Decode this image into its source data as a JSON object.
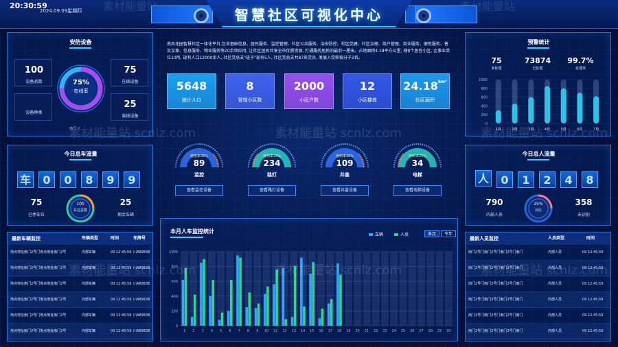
{
  "header": {
    "title": "智慧社区可视化中心",
    "clock": "20:30:59",
    "date": "2024.09.09星期四",
    "ghost_left": "素材能量站",
    "ghost_right": "素材能量站"
  },
  "watermark": "素材能量站 scnlz.com",
  "security": {
    "title": "安防设备",
    "total_value": "100",
    "total_label": "设备总数",
    "types_label": "设备种类",
    "ring_pct": "75%",
    "ring_label": "在线率",
    "ring_fraction": 0.75,
    "online_value": "75",
    "online_label": "在线设备",
    "offline_value": "25",
    "offline_label": "离线设备",
    "footnote": "南门 人"
  },
  "intro": "南风花园智慧社区一体化平台,包含基础信息、居民服务、监控管理、社区公共服务、治安防控、社区党建、社区治理、商户管理、商业服务、便民服务、普及议事、信息服务、物业服务等20余项应用, 让社区居民共享全市优质资源, 打通服务居民的最后一厘米。占地面积4.18平方公里, 辖8个居住小区, 企事业单位10所, 现有人口12000余人, 社区党总支\"班子\"现有5人, 社区党总支共87名党员, 发展入党积极分子2名。",
  "stats": [
    {
      "value": "5648",
      "label": "统计人口",
      "color": "#1aa0f2"
    },
    {
      "value": "8",
      "label": "管辖小区数",
      "color": "#3f63f0"
    },
    {
      "value": "2000",
      "label": "小区户数",
      "color": "#9a4ff2"
    },
    {
      "value": "12",
      "label": "小区楼栋",
      "color": "#3358e8"
    },
    {
      "value": "24.18",
      "unit": "km²",
      "label": "社区面积",
      "color": "#1b9af0"
    }
  ],
  "gauges": [
    {
      "rate_label": "使用率98%",
      "value": "89",
      "name": "监控",
      "button": "查看监控设备",
      "color": "#2f6df0"
    },
    {
      "rate_label": "使用率25%",
      "value": "234",
      "name": "路灯",
      "button": "查看路灯设备",
      "color": "#27c7c0"
    },
    {
      "rate_label": "使用率98%",
      "value": "109",
      "name": "井盖",
      "button": "查看井盖设备",
      "color": "#2f6df0"
    },
    {
      "rate_label": "使用率25%",
      "value": "34",
      "name": "电梯",
      "button": "查看电梯设备",
      "color": "#27c7c0"
    }
  ],
  "alerts": {
    "title": "预警统计",
    "items": [
      {
        "value": "75",
        "label": "未处理"
      },
      {
        "value": "73874",
        "label": "已处理"
      },
      {
        "value": "99.7%",
        "label": "处理率"
      }
    ]
  },
  "alert_chart": {
    "type": "bar",
    "categories": [
      "1月",
      "2月",
      "3月",
      "4月",
      "5月",
      "6月",
      "7月"
    ],
    "values": [
      300,
      450,
      600,
      850,
      800,
      700,
      620
    ],
    "ylim": [
      0,
      1000
    ],
    "yticks": [
      "1000",
      "800",
      "600",
      "400",
      "200",
      "0"
    ]
  },
  "vehicle_flow": {
    "title": "今日总车流量",
    "prefix": "车",
    "digits": [
      "0",
      "0",
      "8",
      "9",
      "9"
    ],
    "parked_value": "75",
    "parked_label": "已停车位",
    "ring_value": "100",
    "ring_label": "车位总数",
    "remain_value": "25",
    "remain_label": "剩余车辆"
  },
  "people_flow": {
    "title": "今日总人流量",
    "prefix": "人",
    "digits": [
      "0",
      "1",
      "2",
      "4",
      "8"
    ],
    "inner_value": "790",
    "inner_label": "内部人员",
    "ring_value": "25%",
    "ring_label": "对比",
    "unknown_value": "358",
    "unknown_label": "未识别"
  },
  "chart_data": {
    "type": "bar",
    "title": "本月人车监控统计",
    "tabs": [
      "本月",
      "今年"
    ],
    "categories": [
      "1",
      "2",
      "3",
      "4",
      "5",
      "6",
      "7",
      "8",
      "9",
      "10",
      "11",
      "12",
      "13",
      "14",
      "15",
      "16",
      "17",
      "18",
      "19",
      "20",
      "21",
      "22",
      "23",
      "24",
      "25",
      "26",
      "27",
      "28",
      "29",
      "30"
    ],
    "xticks": [
      "1",
      "2",
      "3",
      "4",
      "5",
      "6",
      "7",
      "8",
      "9",
      "10",
      "11",
      "12",
      "13",
      "14",
      "15",
      "16",
      "17",
      "18",
      "19",
      "20",
      "21",
      "22",
      "23",
      "24",
      "25",
      "26",
      "27",
      "28",
      "29",
      "30"
    ],
    "yticks": [
      "1000",
      "800",
      "600",
      "400",
      "200",
      "0"
    ],
    "ylim": [
      0,
      1000
    ],
    "series": [
      {
        "name": "车辆",
        "color": "#2ea6ff",
        "values": [
          620,
          120,
          850,
          400,
          80,
          200,
          950,
          250,
          240,
          430,
          560,
          780,
          120,
          920,
          700,
          100,
          300,
          840,
          0,
          0,
          0,
          0,
          0,
          0,
          0,
          0,
          0,
          0,
          0,
          0
        ]
      },
      {
        "name": "人员",
        "color": "#27d98a",
        "values": [
          780,
          420,
          900,
          620,
          180,
          620,
          920,
          450,
          300,
          530,
          760,
          90,
          810,
          260,
          860,
          230,
          360,
          690,
          0,
          0,
          0,
          0,
          0,
          0,
          0,
          0,
          0,
          0,
          0,
          0
        ]
      }
    ]
  },
  "vehicle_table": {
    "title": "最新车辆监控",
    "headers": [
      "车辆类型",
      "时间",
      "车牌号"
    ],
    "rows": [
      {
        "addr": "地点地址南门2号门地点地址南门2号",
        "type": "内部车辆",
        "time": "09 12:45:59",
        "plate": "川A89838"
      },
      {
        "addr": "地点地址南门2号门地点地址南门2号",
        "type": "内部车辆",
        "time": "09 12:45:59",
        "plate": "川A89838"
      },
      {
        "addr": "地点地址南门2号门地点地址南门2号",
        "type": "内部车辆",
        "time": "09 12:45:59",
        "plate": "川A89838"
      },
      {
        "addr": "地点地址南门2号门地点地址南门2号",
        "type": "内部车辆",
        "time": "09 12:45:59",
        "plate": "川A89838"
      },
      {
        "addr": "地点地址南门2号门地点地址南门2号",
        "type": "内部车辆",
        "time": "09 12:45:59",
        "plate": "川A89838"
      },
      {
        "addr": "地点地址南门2号门地点地址南门2号",
        "type": "内部车辆",
        "time": "09 12:45:59",
        "plate": "川A89838"
      }
    ]
  },
  "people_table": {
    "title": "最新人员监控",
    "headers": [
      "人员类型",
      "时间"
    ],
    "rows": [
      {
        "addr": "南门2号门南门2号门南门2号门南门",
        "type": "内部人员",
        "time": "09 12:45:59"
      },
      {
        "addr": "南门2号门南门2号门南门2号门南门",
        "type": "内部人员",
        "time": "09 12:45:59"
      },
      {
        "addr": "南门2号门南门2号门南门2号门南门",
        "type": "内部人员",
        "time": "09 12:45:59"
      },
      {
        "addr": "南门2号门南门2号门南门2号门南门",
        "type": "内部人员",
        "time": "09 12:45:59"
      },
      {
        "addr": "南门2号门南门2号门南门2号门南门",
        "type": "内部人员",
        "time": "09 12:45:59"
      },
      {
        "addr": "南门2号门南门2号门南门2号门南门",
        "type": "内部人员",
        "time": "09 12:45:59"
      }
    ]
  }
}
